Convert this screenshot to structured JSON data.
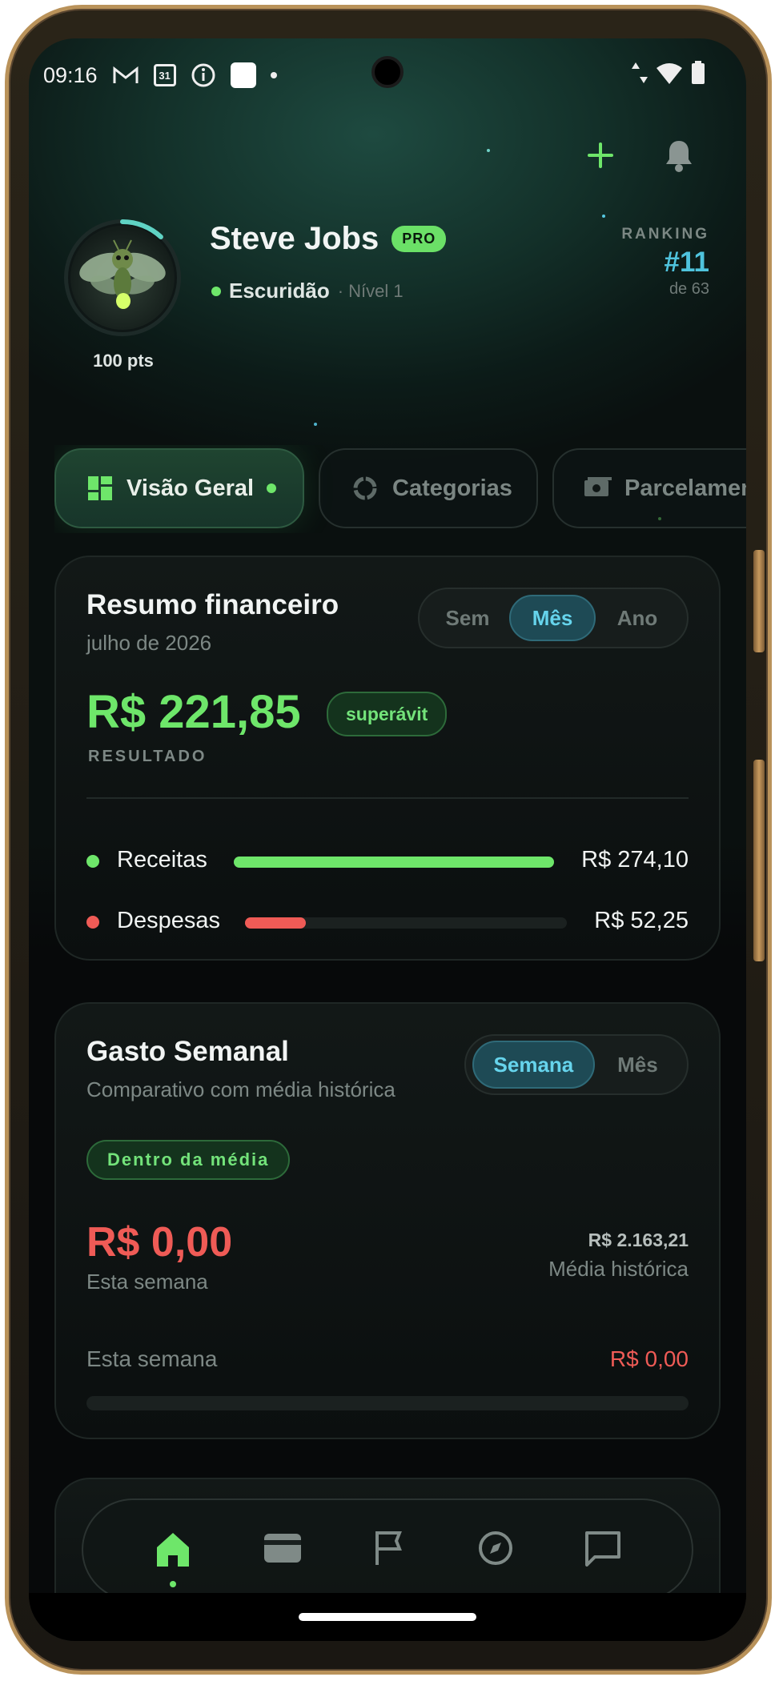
{
  "statusbar": {
    "time": "09:16",
    "icons": [
      "gmail-icon",
      "calendar-icon",
      "info-icon",
      "app-square-icon",
      "dot-icon"
    ],
    "calendar_day": "31"
  },
  "header": {
    "add_icon": "plus-icon",
    "bell_icon": "bell-icon"
  },
  "profile": {
    "name": "Steve Jobs",
    "badge": "PRO",
    "status": "Escuridão",
    "level": "· Nível 1",
    "points": "100 pts",
    "ranking_label": "RANKING",
    "ranking_value": "#11",
    "ranking_of": "de 63",
    "ring_progress": 0.12
  },
  "tabs": [
    {
      "label": "Visão Geral",
      "icon": "grid-icon",
      "active": true
    },
    {
      "label": "Categorias",
      "icon": "donut-icon",
      "active": false
    },
    {
      "label": "Parcelamentos",
      "icon": "cash-icon",
      "active": false
    }
  ],
  "summary": {
    "title": "Resumo financeiro",
    "subtitle": "julho de 2026",
    "periods": [
      "Sem",
      "Mês",
      "Ano"
    ],
    "selected_period": "Mês",
    "amount": "R$ 221,85",
    "badge": "superávit",
    "result_label": "RESULTADO",
    "income_label": "Receitas",
    "income_value": "R$ 274,10",
    "income_fraction": 1.0,
    "expense_label": "Despesas",
    "expense_value": "R$ 52,25",
    "expense_fraction": 0.19
  },
  "weekly": {
    "title": "Gasto Semanal",
    "subtitle": "Comparativo com média histórica",
    "toggle": [
      "Semana",
      "Mês"
    ],
    "selected": "Semana",
    "badge": "Dentro da média",
    "amount": "R$ 0,00",
    "amount_label": "Esta semana",
    "avg_value": "R$ 2.163,21",
    "avg_label": "Média histórica",
    "row_label": "Esta semana",
    "row_value": "R$ 0,00",
    "progress": 0
  },
  "colors": {
    "accent_green": "#6ee66a",
    "accent_red": "#ef5b56",
    "accent_cyan": "#66d4ec",
    "ranking": "#4fc3dd"
  },
  "bottom_nav": [
    {
      "name": "home-icon",
      "active": true
    },
    {
      "name": "wallet-icon",
      "active": false
    },
    {
      "name": "flag-icon",
      "active": false
    },
    {
      "name": "compass-icon",
      "active": false
    },
    {
      "name": "chat-icon",
      "active": false
    }
  ]
}
